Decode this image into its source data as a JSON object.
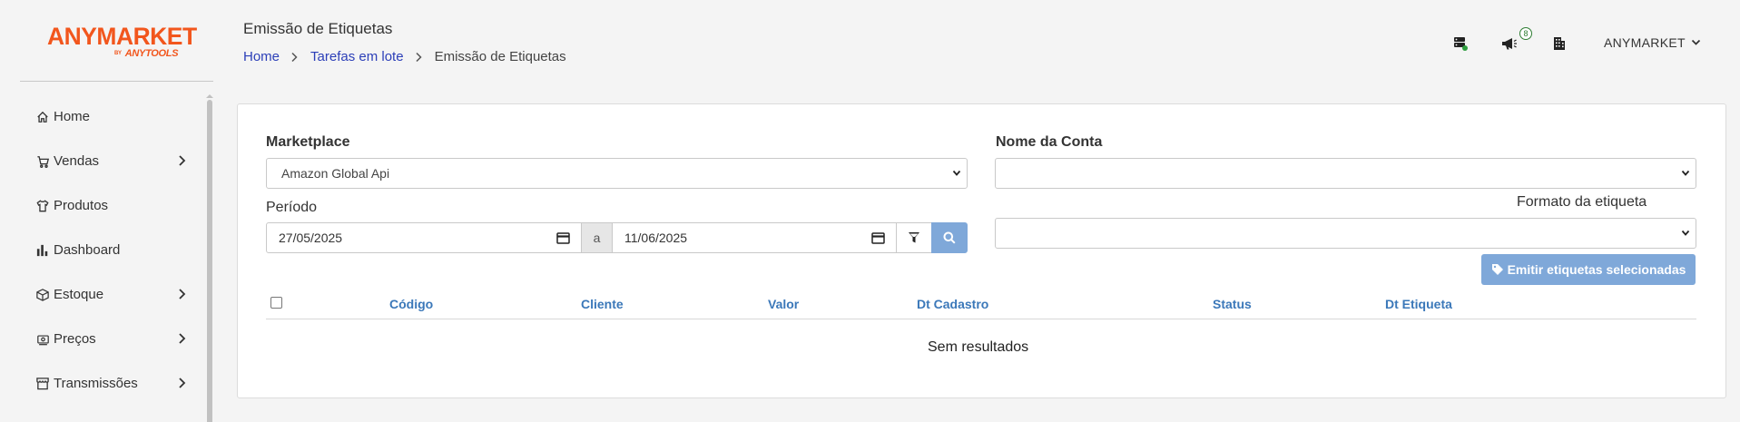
{
  "brand": {
    "logo_main": "ANYMARKET",
    "logo_by": "BY",
    "logo_sub": "ANYTOOLS",
    "color": "#f2561d"
  },
  "header": {
    "title": "Emissão de Etiquetas",
    "breadcrumb": [
      "Home",
      "Tarefas em lote",
      "Emissão de Etiquetas"
    ],
    "notification_count": "8",
    "user": "ANYMARKET"
  },
  "sidebar": {
    "items": [
      {
        "label": "Home",
        "icon": "home-icon",
        "has_submenu": false
      },
      {
        "label": "Vendas",
        "icon": "cart-icon",
        "has_submenu": true
      },
      {
        "label": "Produtos",
        "icon": "shirt-icon",
        "has_submenu": false
      },
      {
        "label": "Dashboard",
        "icon": "bar-chart-icon",
        "has_submenu": false
      },
      {
        "label": "Estoque",
        "icon": "box-icon",
        "has_submenu": true
      },
      {
        "label": "Preços",
        "icon": "cash-icon",
        "has_submenu": true
      },
      {
        "label": "Transmissões",
        "icon": "store-icon",
        "has_submenu": true
      }
    ]
  },
  "form": {
    "marketplace_label": "Marketplace",
    "marketplace_value": "Amazon Global Api",
    "conta_label": "Nome da Conta",
    "conta_value": "",
    "periodo_label": "Período",
    "date_from": "27/05/2025",
    "date_sep": "a",
    "date_to": "11/06/2025",
    "formato_label": "Formato da etiqueta",
    "formato_value": "",
    "emit_button": "Emitir etiquetas selecionadas"
  },
  "table": {
    "columns": [
      "Código",
      "Cliente",
      "Valor",
      "Dt Cadastro",
      "Status",
      "Dt Etiqueta"
    ],
    "empty_text": "Sem resultados"
  },
  "colors": {
    "accent": "#7fa8d9",
    "link": "#2c3fb8",
    "column_header": "#3b78b9",
    "status_ok": "#2e7d32"
  }
}
